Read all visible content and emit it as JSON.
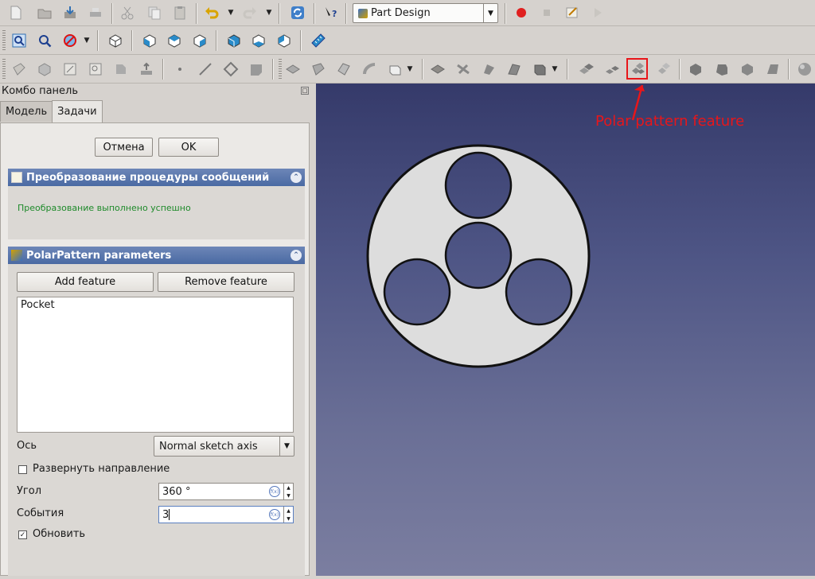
{
  "workbench": {
    "selected": "Part Design"
  },
  "annotation": {
    "text": "Polar pattern feature",
    "color": "#e8161a"
  },
  "combo_panel": {
    "title": "Комбо панель",
    "tabs": [
      {
        "label": "Модель"
      },
      {
        "label": "Задачи"
      }
    ],
    "active_tab": "Задачи",
    "cancel_label": "Отмена",
    "ok_label": "OK"
  },
  "conversion_section": {
    "title": "Преобразование процедуры сообщений",
    "message": "Преобразование выполнено успешно",
    "message_color": "#1e8a2a"
  },
  "polar_section": {
    "title": "PolarPattern parameters",
    "add_feature_label": "Add feature",
    "remove_feature_label": "Remove feature",
    "features": [
      "Pocket"
    ],
    "axis_label": "Ось",
    "axis_value": "Normal sketch axis",
    "reverse_label": "Развернуть направление",
    "reverse_checked": false,
    "angle_label": "Угол",
    "angle_value": "360 °",
    "occurrences_label": "События",
    "occurrences_value": "3",
    "update_label": "Обновить",
    "update_checked": true
  },
  "colors": {
    "section_header": "#4a6aa3",
    "viewport_top": "#353a6a",
    "viewport_bottom": "#7b7ea0",
    "part_face": "#dddddd"
  },
  "icons": {
    "toolbar1": [
      "new-icon",
      "open-icon",
      "save-icon",
      "print-icon",
      "cut-icon",
      "copy-icon",
      "paste-icon",
      "undo-icon",
      "redo-icon",
      "refresh-icon",
      "whats-this-icon",
      "macro-record-icon",
      "macro-stop-icon",
      "macro-edit-icon",
      "macro-run-icon"
    ],
    "toolbar2": [
      "fit-all-icon",
      "fit-selection-icon",
      "draw-style-icon",
      "isometric-icon",
      "front-view-icon",
      "top-view-icon",
      "right-view-icon",
      "rear-view-icon",
      "bottom-view-icon",
      "left-view-icon",
      "measure-icon"
    ]
  }
}
